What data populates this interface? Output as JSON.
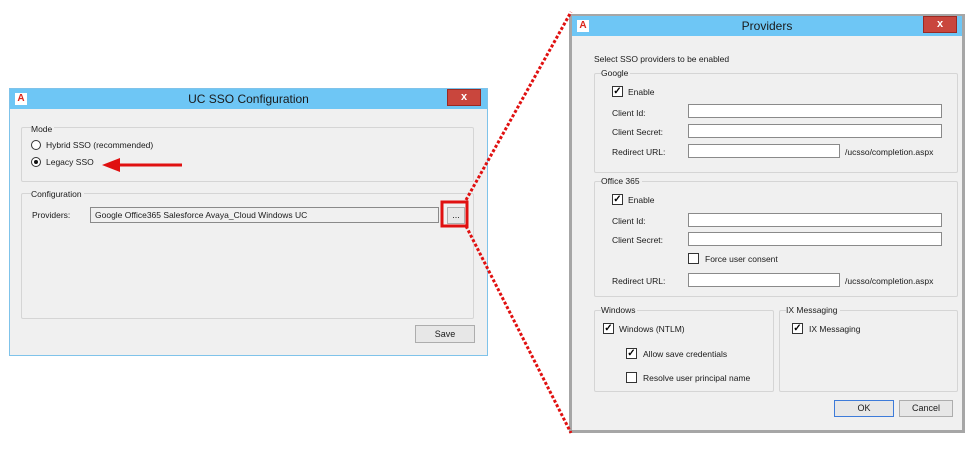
{
  "main_dialog": {
    "title": "UC SSO Configuration",
    "mode_group": "Mode",
    "radio_hybrid": "Hybrid SSO (recommended)",
    "radio_legacy": "Legacy SSO",
    "configuration_group": "Configuration",
    "providers_label": "Providers:",
    "providers_value": "Google Office365 Salesforce Avaya_Cloud Windows UC",
    "browse_label": "...",
    "save_label": "Save",
    "close_label": "x",
    "logo": "A"
  },
  "providers_dialog": {
    "title": "Providers",
    "close_label": "x",
    "logo": "A",
    "intro": "Select SSO providers to be enabled",
    "google": {
      "group": "Google",
      "enable_label": "Enable",
      "enable_checked": true,
      "client_id_label": "Client Id:",
      "client_secret_label": "Client Secret:",
      "redirect_label": "Redirect URL:",
      "redirect_suffix": "/ucsso/completion.aspx"
    },
    "office365": {
      "group": "Office 365",
      "enable_label": "Enable",
      "enable_checked": true,
      "client_id_label": "Client Id:",
      "client_secret_label": "Client Secret:",
      "force_consent_label": "Force user consent",
      "force_consent_checked": false,
      "redirect_label": "Redirect URL:",
      "redirect_suffix": "/ucsso/completion.aspx"
    },
    "windows": {
      "group": "Windows",
      "ntlm_label": "Windows (NTLM)",
      "ntlm_checked": true,
      "allow_save_label": "Allow save credentials",
      "allow_save_checked": true,
      "resolve_upn_label": "Resolve user principal name",
      "resolve_upn_checked": false
    },
    "ix": {
      "group": "IX Messaging",
      "ix_label": "IX Messaging",
      "ix_checked": true
    },
    "ok_label": "OK",
    "cancel_label": "Cancel"
  },
  "colors": {
    "titlebar": "#6ec6f5",
    "annotation_red": "#e01010",
    "close_red": "#c9463d"
  }
}
